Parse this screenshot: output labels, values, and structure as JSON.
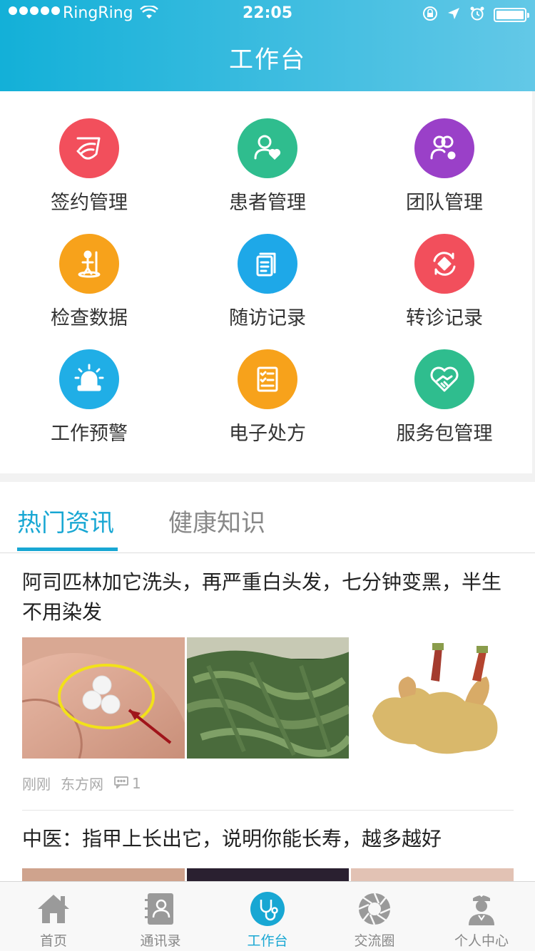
{
  "status_bar": {
    "carrier": "RingRing",
    "time": "22:05"
  },
  "header": {
    "title": "工作台"
  },
  "grid": [
    {
      "label": "签约管理",
      "color": "#f24f5c",
      "icon": "sign-contract-icon"
    },
    {
      "label": "患者管理",
      "color": "#2fbd8e",
      "icon": "patient-icon"
    },
    {
      "label": "团队管理",
      "color": "#9a40c8",
      "icon": "team-icon"
    },
    {
      "label": "检查数据",
      "color": "#f7a21b",
      "icon": "check-data-icon"
    },
    {
      "label": "随访记录",
      "color": "#1ea8e8",
      "icon": "followup-record-icon"
    },
    {
      "label": "转诊记录",
      "color": "#f24f5c",
      "icon": "referral-icon"
    },
    {
      "label": "工作预警",
      "color": "#20aee6",
      "icon": "alarm-icon"
    },
    {
      "label": "电子处方",
      "color": "#f7a21b",
      "icon": "prescription-icon"
    },
    {
      "label": "服务包管理",
      "color": "#2fbd8e",
      "icon": "service-package-icon"
    }
  ],
  "tabs": {
    "active": "热门资讯",
    "inactive": "健康知识",
    "accent": "#18a7d3"
  },
  "news": [
    {
      "title": "阿司匹林加它洗头，再严重白头发，七分钟变黑，半生不用染发",
      "time": "刚刚",
      "source": "东方网",
      "comments": "1"
    },
    {
      "title": "中医：指甲上长出它，说明你能长寿，越多越好"
    }
  ],
  "tabbar": [
    {
      "label": "首页",
      "icon": "home-icon"
    },
    {
      "label": "通讯录",
      "icon": "contacts-icon"
    },
    {
      "label": "工作台",
      "icon": "workbench-stethoscope-icon"
    },
    {
      "label": "交流圈",
      "icon": "shutter-icon"
    },
    {
      "label": "个人中心",
      "icon": "doctor-profile-icon"
    }
  ]
}
